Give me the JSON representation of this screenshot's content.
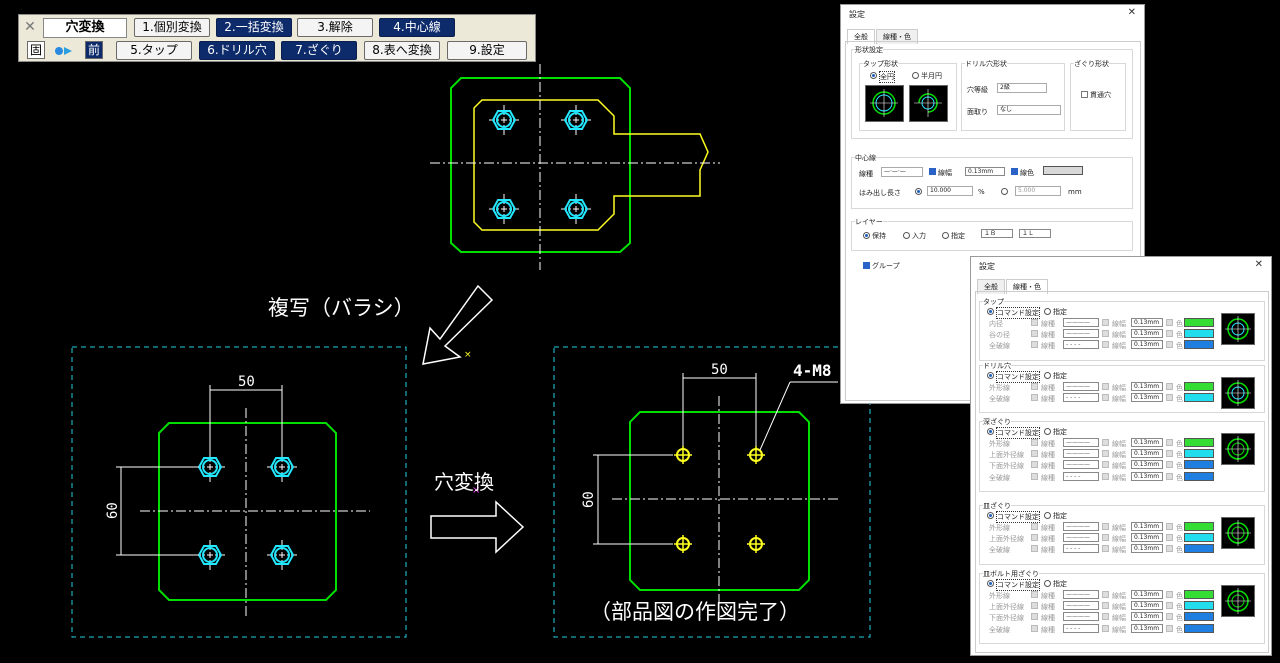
{
  "toolbar": {
    "title": "穴変換",
    "close": "✕",
    "fix": "固",
    "prev": "前",
    "buttons": [
      "1.個別変換",
      "2.一括変換",
      "3.解除",
      "4.中心線",
      "5.タップ",
      "6.ドリル穴",
      "7.ざぐり",
      "8.表へ変換",
      "9.設定"
    ]
  },
  "captions": {
    "copy": "複写（バラシ）",
    "convert": "穴変換",
    "done": "（部品図の作図完了）"
  },
  "drawing": {
    "dim_width": "50",
    "dim_height": "60",
    "thread_label": "4-M8"
  },
  "dialog1": {
    "title": "設定",
    "close": "✕",
    "tabs": [
      "全般",
      "線種・色"
    ],
    "shape_group": "形状設定",
    "tap_shape": "タップ形状",
    "tap_full": "全円",
    "tap_half": "半月円",
    "drill_shape": "ドリル穴形状",
    "hole_grade": "穴等級",
    "hole_grade_value": "2級",
    "chamfer": "面取り",
    "chamfer_value": "なし",
    "counterbore_shape": "ざぐり形状",
    "through_hole": "貫通穴",
    "centerline_group": "中心線",
    "linetype": "線種",
    "linewidth": "線幅",
    "linewidth_value": "0.13mm",
    "linecolor": "線色",
    "overhang": "はみ出し長さ",
    "overhang_value1": "10.000",
    "overhang_unit1": "%",
    "overhang_value2": "5.000",
    "overhang_unit2": "mm",
    "layer_group": "レイヤー",
    "layer_keep": "保持",
    "layer_input": "入力",
    "layer_specify": "指定",
    "layer_b1": "１Ｂ",
    "layer_b2": "１Ｌ",
    "group": "グループ"
  },
  "dialog2": {
    "title": "設定",
    "close": "✕",
    "tabs": [
      "全般",
      "線種・色"
    ],
    "cmd_setting": "コマンド設定",
    "specify": "指定",
    "linetype": "線種",
    "linewidth": "線幅",
    "color": "色",
    "width_value": "0.13mm",
    "sections": [
      {
        "name": "タップ",
        "rows": [
          "内径",
          "谷の径",
          "全破線"
        ]
      },
      {
        "name": "ドリル穴",
        "rows": [
          "外形線",
          "全破線"
        ]
      },
      {
        "name": "深ざぐり",
        "rows": [
          "外形線",
          "上面外径線",
          "下面外径線",
          "全破線"
        ]
      },
      {
        "name": "皿ざぐり",
        "rows": [
          "外形線",
          "上面外径線",
          "全破線"
        ]
      },
      {
        "name": "皿ボルト用ざぐり",
        "rows": [
          "外形線",
          "上面外径線",
          "下面外径線",
          "全破線"
        ]
      }
    ]
  },
  "colors": {
    "green": "#00e000",
    "cyan": "#22e8ff",
    "yellow": "#ffff20",
    "navy": "#0d2b6b",
    "swatch_green": "#33dd33",
    "swatch_cyan": "#22ddee",
    "swatch_blue": "#1f7fe0"
  }
}
